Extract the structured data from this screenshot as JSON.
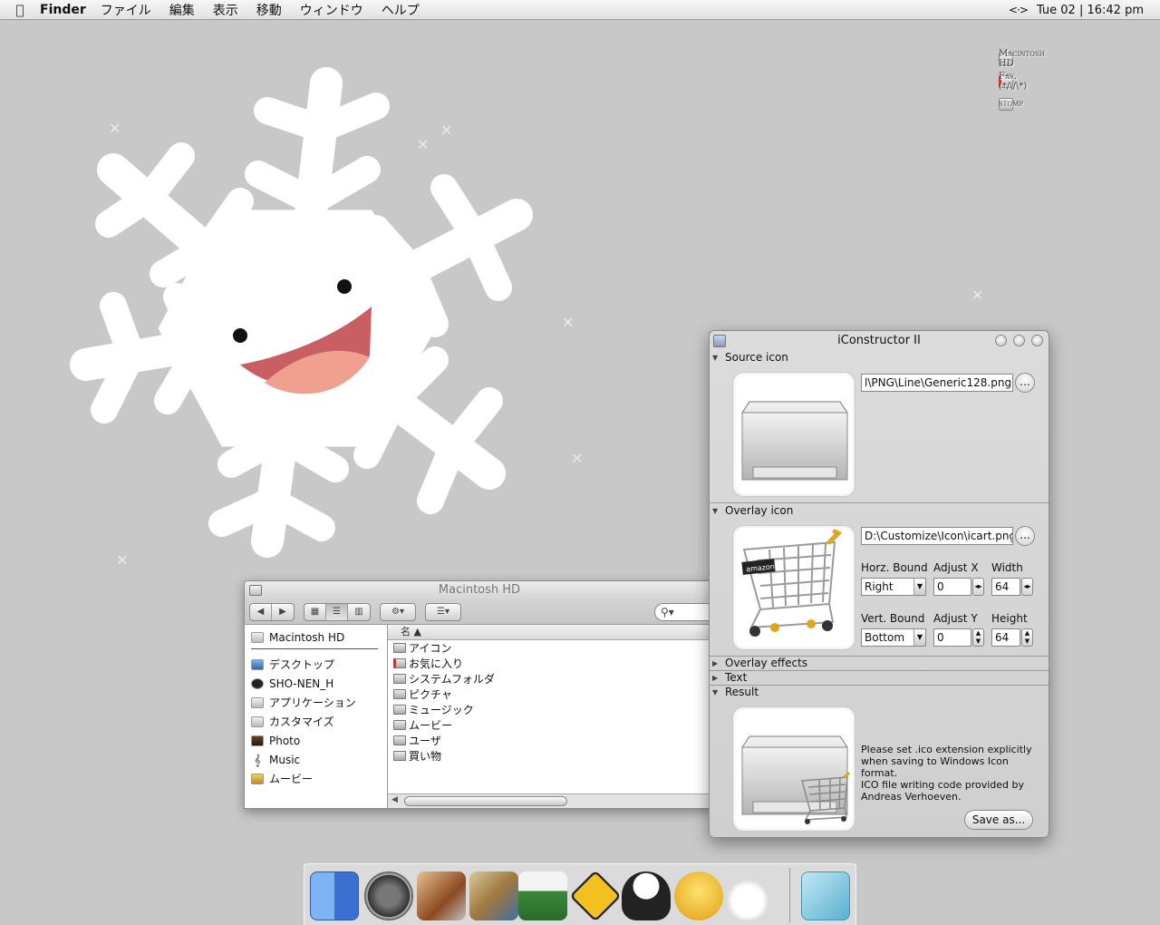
{
  "menubar": {
    "app_name": "Finder",
    "items": [
      "ファイル",
      "編集",
      "表示",
      "移動",
      "ウィンドウ",
      "ヘルプ"
    ],
    "clock": "Tue 02 | 16:42 pm"
  },
  "desktop_icons": [
    {
      "label": "Macintosh HD"
    },
    {
      "label": "Fav. (*/\\/\\*)"
    },
    {
      "label": "stomp"
    }
  ],
  "finder": {
    "title": "Macintosh HD",
    "sidebar_top": "Macintosh HD",
    "sidebar": [
      "デスクトップ",
      "SHO-NEN_H",
      "アプリケーション",
      "カスタマイズ",
      "Photo",
      "Music",
      "ムービー"
    ],
    "column_header": "名",
    "files": [
      "アイコン",
      "お気に入り",
      "システムフォルダ",
      "ピクチャ",
      "ミュージック",
      "ムービー",
      "ユーザ",
      "買い物"
    ]
  },
  "iconstructor": {
    "title": "iConstructor II",
    "source_section": "Source icon",
    "source_path": "l\\PNG\\Line\\Generic128.png",
    "dots": "...",
    "overlay_section": "Overlay icon",
    "overlay_path": "D:\\Customize\\Icon\\icart.png",
    "horz_bound_label": "Horz. Bound",
    "horz_bound_value": "Right",
    "adjust_x_label": "Adjust X",
    "adjust_x_value": "0",
    "width_label": "Width",
    "width_value": "64",
    "vert_bound_label": "Vert. Bound",
    "vert_bound_value": "Bottom",
    "adjust_y_label": "Adjust Y",
    "adjust_y_value": "0",
    "height_label": "Height",
    "height_value": "64",
    "overlay_effects_section": "Overlay effects",
    "text_section": "Text",
    "result_section": "Result",
    "note_lines": [
      "Please set .ico extension explicitly",
      "when saving to Windows Icon",
      "format.",
      "ICO file writing code provided by",
      "Andreas Verhoeven."
    ],
    "save_button": "Save as..."
  },
  "dock": {
    "items": [
      "finder-icon",
      "dashboard-icon",
      "iphoto-icon",
      "package-icon",
      "truck-icon",
      "transmit-icon",
      "bird-icon",
      "duck-icon",
      "snowman-icon",
      "box-icon"
    ]
  }
}
